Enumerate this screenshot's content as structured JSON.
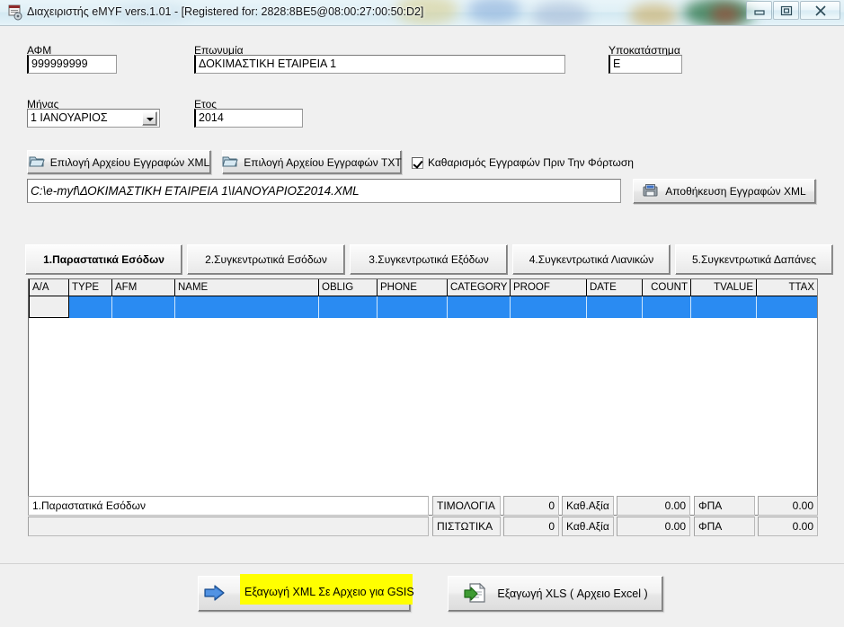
{
  "window": {
    "title": "Διαχειριστής eMYF  vers.1.01 - [Registered for: 2828:8BE5@08:00:27:00:50:D2]",
    "app_icon": "app-icon",
    "minimize_label": "Minimize",
    "maximize_label": "Maximize",
    "close_label": "Close"
  },
  "form": {
    "afm_label": "ΑΦΜ",
    "afm_value": "999999999",
    "eponymia_label": "Επωνυμία",
    "eponymia_value": "ΔΟΚΙΜΑΣΤΙΚΗ ΕΤΑΙΡΕΙΑ 1",
    "ypokatastima_label": "Υποκατάστημα",
    "ypokatastima_value": "E",
    "minas_label": "Μήνας",
    "minas_value": "1  ΙΑΝΟΥΑΡΙΟΣ",
    "etos_label": "Ετος",
    "etos_value": "2014"
  },
  "filebar": {
    "select_xml_label": "Επιλογή Αρχείου Εγγραφών XML",
    "select_txt_label": "Επιλογή Αρχείου Εγγραφών TXT",
    "clear_checkbox_label": "Καθαρισμός Εγγραφών Πριν Την Φόρτωση",
    "clear_checkbox_checked": true,
    "path_value": "C:\\e-myf\\ΔΟΚΙΜΑΣΤΙΚΗ ΕΤΑΙΡΕΙΑ 1\\ΙΑΝΟΥΑΡΙΟΣ2014.XML",
    "save_xml_label": "Αποθήκευση Εγγραφών XML",
    "folder_icon": "folder-icon",
    "save_icon": "save-disk-icon"
  },
  "tabs": [
    {
      "label": "1.Παραστατικά Εσόδων",
      "active": true
    },
    {
      "label": "2.Συγκεντρωτικά Εσόδων",
      "active": false
    },
    {
      "label": "3.Συγκεντρωτικά Εξόδων",
      "active": false
    },
    {
      "label": "4.Συγκεντρωτικά Λιανικών",
      "active": false
    },
    {
      "label": "5.Συγκεντρωτικά Δαπάνες",
      "active": false
    }
  ],
  "grid": {
    "columns": [
      {
        "label": "A/A",
        "align": "left"
      },
      {
        "label": "TYPE",
        "align": "left"
      },
      {
        "label": "AFM",
        "align": "left"
      },
      {
        "label": "NAME",
        "align": "left"
      },
      {
        "label": "OBLIG",
        "align": "left"
      },
      {
        "label": "PHONE",
        "align": "left"
      },
      {
        "label": "CATEGORY",
        "align": "left"
      },
      {
        "label": "PROOF",
        "align": "left"
      },
      {
        "label": "DATE",
        "align": "left"
      },
      {
        "label": "COUNT",
        "align": "right"
      },
      {
        "label": "TVALUE",
        "align": "right"
      },
      {
        "label": "TTAX",
        "align": "right"
      }
    ],
    "rows": [
      {
        "selected": true,
        "cells": [
          "",
          "",
          "",
          "",
          "",
          "",
          "",
          "",
          "",
          "",
          "",
          ""
        ]
      }
    ]
  },
  "summary": {
    "section_label": "1.Παραστατικά Εσόδων",
    "section_label_2": "",
    "rows": [
      {
        "kind_label": "ΤΙΜΟΛΟΓΙΑ",
        "count_value": "0",
        "net_label": "Καθ.Αξία",
        "net_value": "0.00",
        "vat_label": "ΦΠΑ",
        "vat_value": "0.00"
      },
      {
        "kind_label": "ΠΙΣΤΩΤΙΚΑ",
        "count_value": "0",
        "net_label": "Καθ.Αξία",
        "net_value": "0.00",
        "vat_label": "ΦΠΑ",
        "vat_value": "0.00"
      }
    ]
  },
  "actions": {
    "export_xml_label": "Εξαγωγή XML Σε Αρχειο για GSIS",
    "export_xml_icon": "blue-arrow-icon",
    "export_xml_highlighted": true,
    "export_xls_label": "Εξαγωγή XLS ( Αρχειο Excel )",
    "export_xls_icon": "document-export-icon"
  },
  "colors": {
    "grid_selection": "#2a8bf2",
    "highlight": "#ffff00",
    "window_face": "#f0f0f0",
    "titlebar_glass": "#e4f2f8"
  }
}
